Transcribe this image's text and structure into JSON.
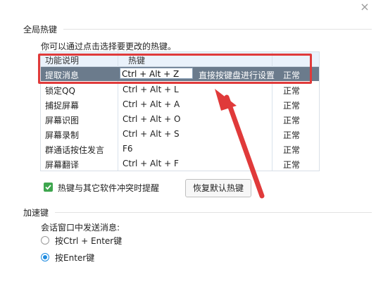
{
  "section_global": "全局热键",
  "hint": "你可以通过点击选择要更改的热键。",
  "table": {
    "headers": [
      "功能说明",
      "热键"
    ],
    "rows": [
      {
        "name": "提取消息",
        "key": "Ctrl + Alt + Z",
        "note": "直接按键盘进行设置",
        "status": "正常"
      },
      {
        "name": "锁定QQ",
        "key": "Ctrl + Alt + L",
        "status": "正常"
      },
      {
        "name": "捕捉屏幕",
        "key": "Ctrl + Alt + A",
        "status": "正常"
      },
      {
        "name": "屏幕识图",
        "key": "Ctrl + Alt + O",
        "status": "正常"
      },
      {
        "name": "屏幕录制",
        "key": "Ctrl + Alt + S",
        "status": "正常"
      },
      {
        "name": "群通话按住发言",
        "key": "F6",
        "status": "正常"
      },
      {
        "name": "屏幕翻译",
        "key": "Ctrl + Alt + F",
        "status": "正常"
      }
    ]
  },
  "conflict_checkbox_label": "热键与其它软件冲突时提醒",
  "restore_button": "恢复默认热键",
  "section_accel": "加速键",
  "send_hint": "会话窗口中发送消息:",
  "radio_options": [
    "按Ctrl + Enter键",
    "按Enter键"
  ],
  "colors": {
    "highlight": "#e03a3a",
    "selected_row": "#6b7b8c",
    "check_green": "#3ea64e",
    "radio_blue": "#1e8be0"
  }
}
